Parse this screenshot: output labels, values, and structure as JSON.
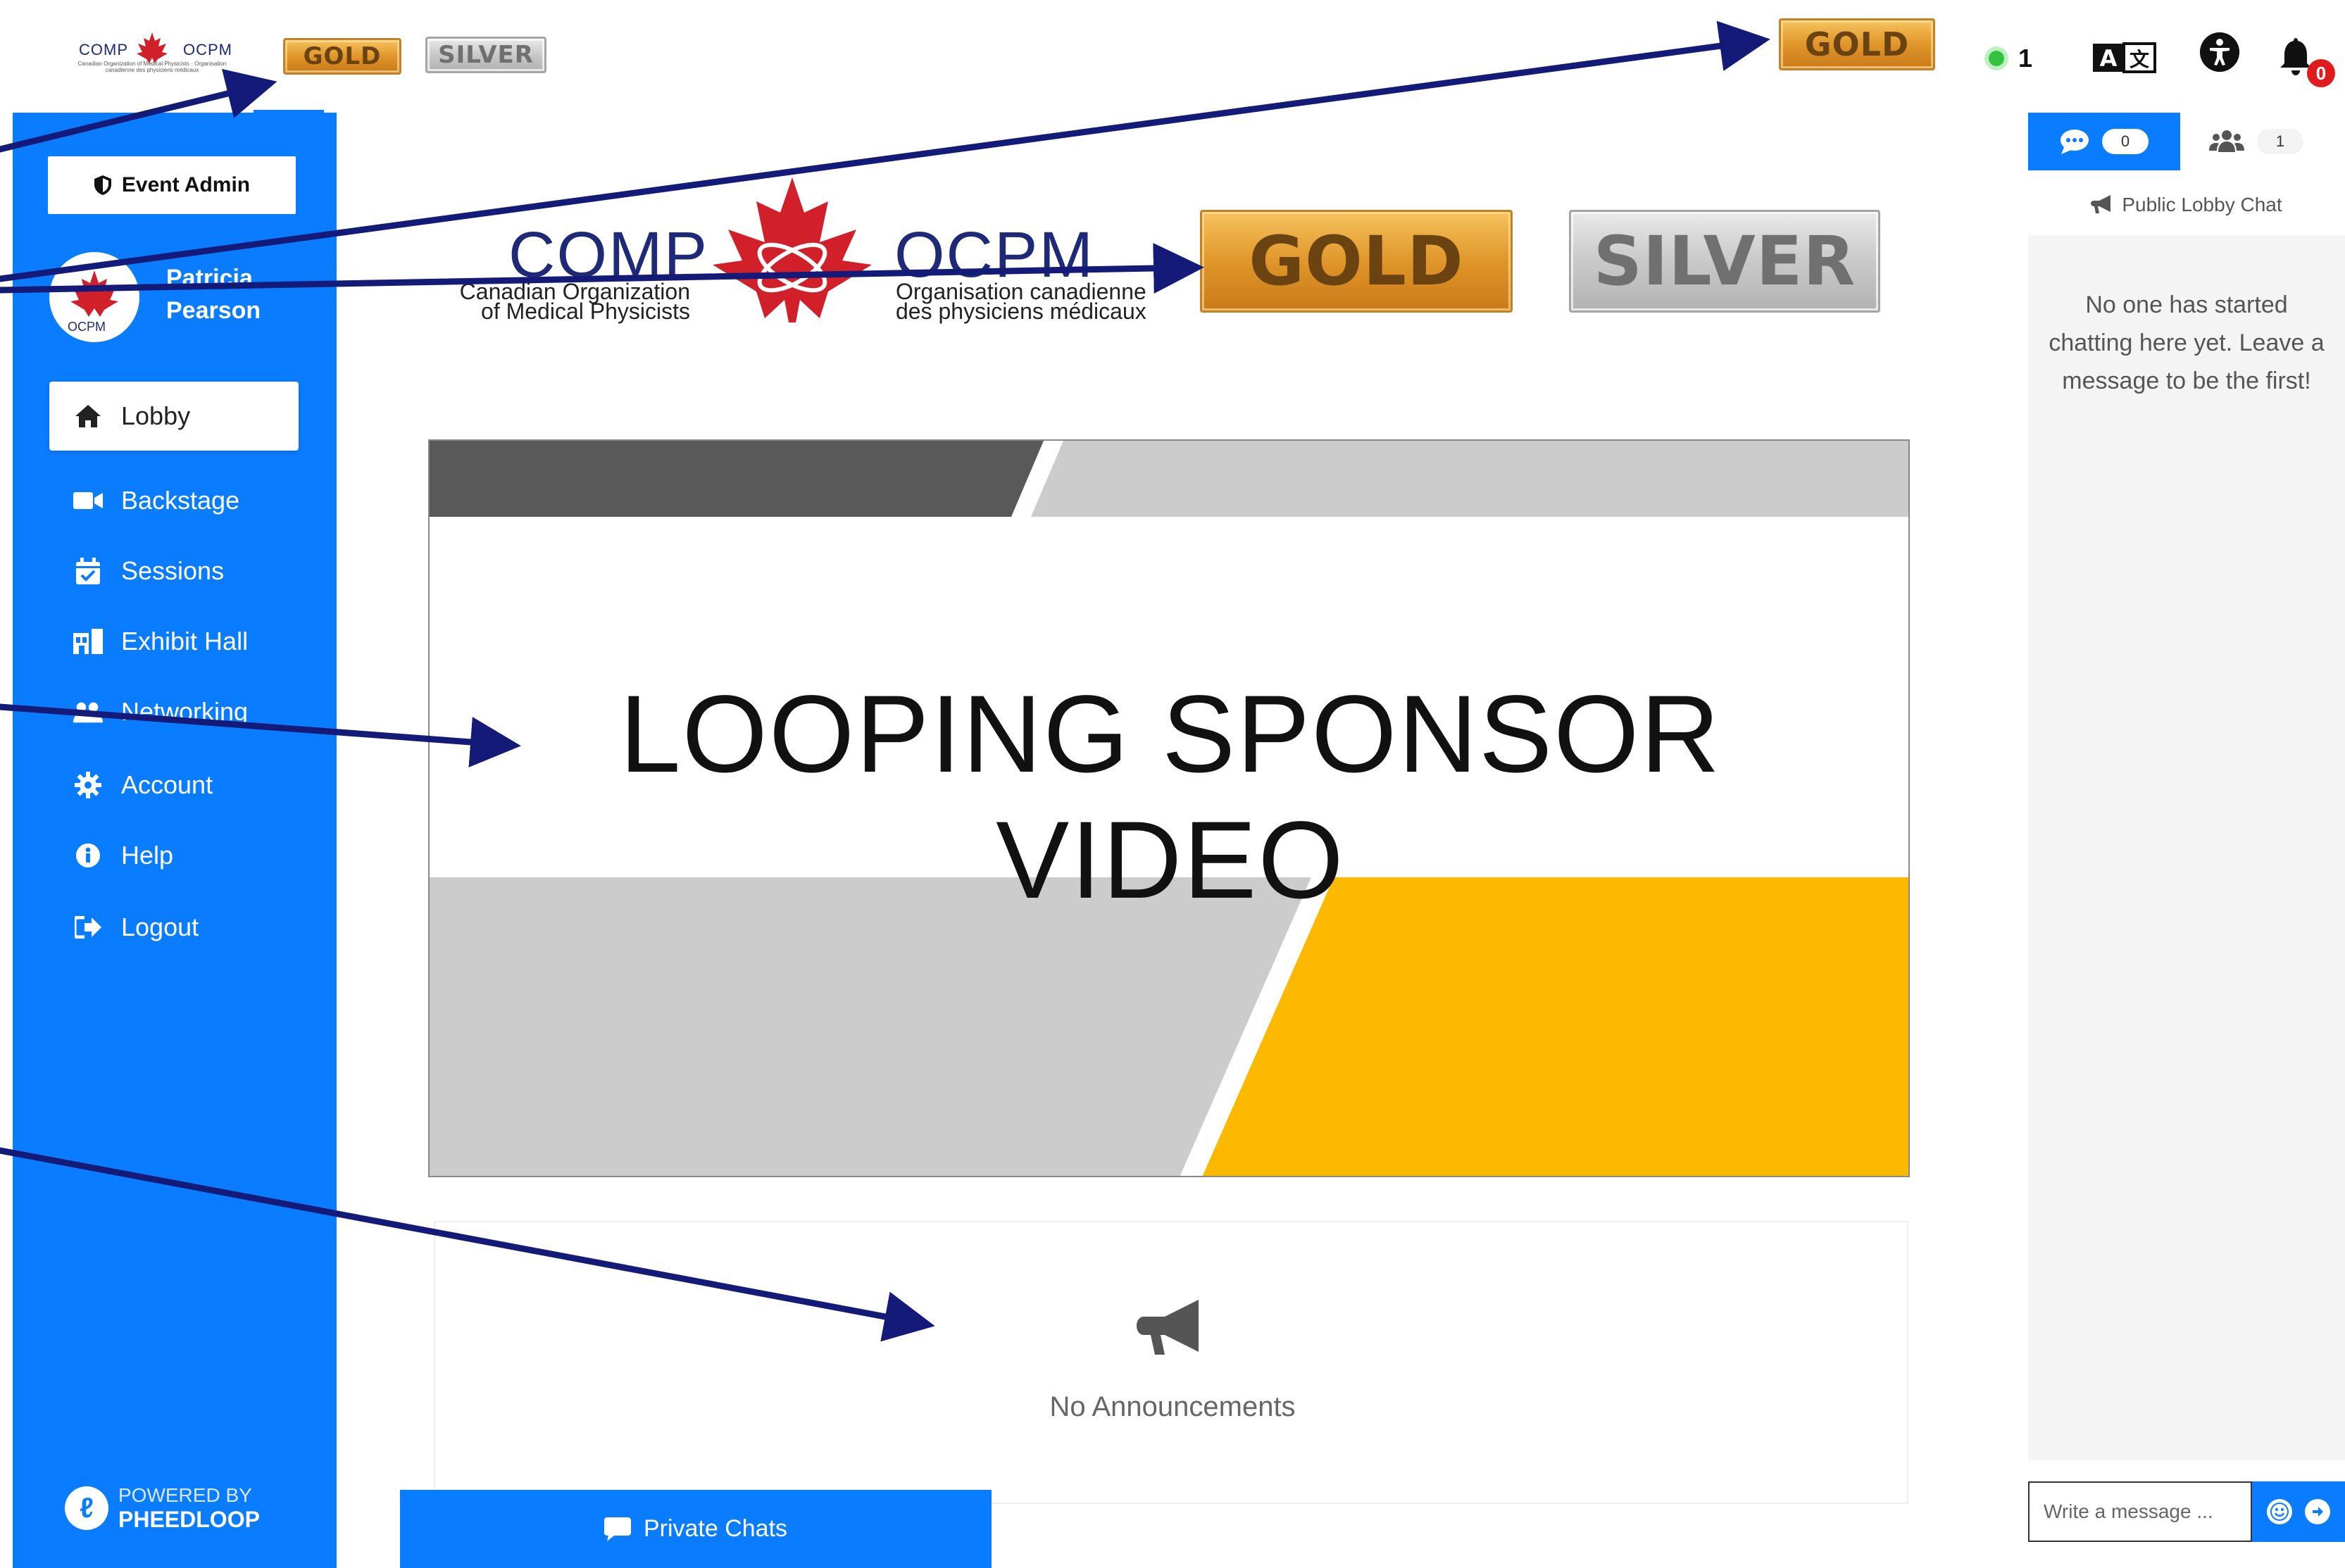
{
  "header": {
    "logo_comp": "COMP",
    "logo_ocpm": "OCPM",
    "logo_sub": "Canadian Organization of Medical Physicists · Organisation canadienne des physiciens médicaux",
    "gold_label": "GOLD",
    "silver_label": "SILVER",
    "online_count": "1",
    "notification_count": "0"
  },
  "sidebar": {
    "admin_button": "Event Admin",
    "user_first": "Patricia",
    "user_last": "Pearson",
    "avatar_text": "OCPM",
    "items": [
      {
        "label": "Lobby",
        "icon": "home-icon",
        "active": true
      },
      {
        "label": "Backstage",
        "icon": "video-camera-icon",
        "active": false
      },
      {
        "label": "Sessions",
        "icon": "calendar-check-icon",
        "active": false
      },
      {
        "label": "Exhibit Hall",
        "icon": "exhibit-hall-icon",
        "active": false
      },
      {
        "label": "Networking",
        "icon": "users-icon",
        "active": false
      },
      {
        "label": "Account",
        "icon": "gear-icon",
        "active": false
      },
      {
        "label": "Help",
        "icon": "info-icon",
        "active": false
      },
      {
        "label": "Logout",
        "icon": "logout-icon",
        "active": false
      }
    ],
    "powered_by": "POWERED BY",
    "powered_brand": "PHEEDLOOP"
  },
  "main": {
    "banner": {
      "comp": "COMP",
      "ocpm": "OCPM",
      "english_line1": "Canadian Organization",
      "english_line2": "of Medical Physicists",
      "french_line1": "Organisation canadienne",
      "french_line2": "des physiciens médicaux"
    },
    "gold_label": "GOLD",
    "silver_label": "SILVER",
    "video_title": "LOOPING SPONSOR VIDEO",
    "announcements_empty": "No Announcements",
    "private_chats": "Private Chats"
  },
  "chat": {
    "chat_count": "0",
    "people_count": "1",
    "heading": "Public Lobby Chat",
    "empty_message": "No one has started chatting here yet. Leave a message to be the first!",
    "input_placeholder": "Write a message ..."
  },
  "colors": {
    "primary": "#0a7cff",
    "gold": "#e0962a",
    "silver": "#c9c9c9",
    "video_yellow": "#fcb900",
    "video_dark_gray": "#595959",
    "video_light_gray": "#cccccc",
    "arrow": "#131a78",
    "online": "#34c240",
    "notification": "#e01b1b"
  }
}
